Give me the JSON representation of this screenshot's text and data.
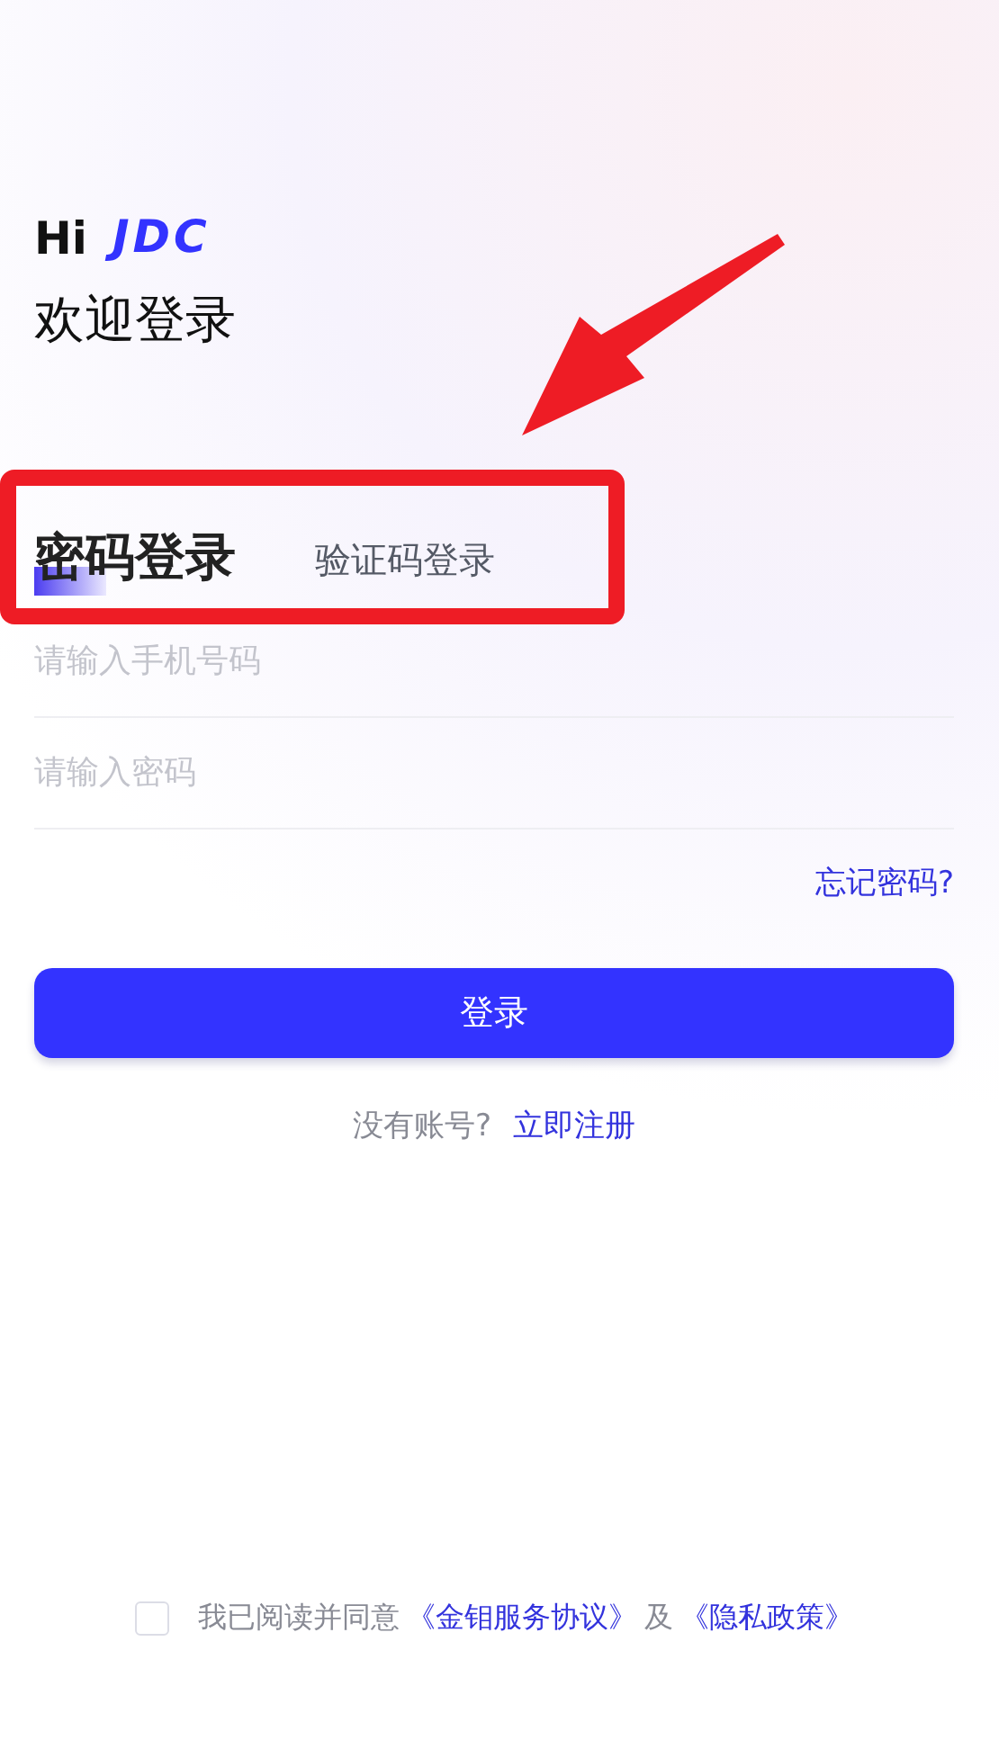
{
  "greeting": {
    "hi": "Hi",
    "brand": "JDC",
    "welcome": "欢迎登录"
  },
  "tabs": [
    {
      "label": "密码登录",
      "selected": true
    },
    {
      "label": "验证码登录",
      "selected": false
    }
  ],
  "fields": [
    {
      "placeholder": "请输入手机号码"
    },
    {
      "placeholder": "请输入密码"
    }
  ],
  "forgot_link": "忘记密码?",
  "login_button": "登录",
  "register": {
    "prompt": "没有账号?",
    "link": "立即注册"
  },
  "agreement": {
    "checked": false,
    "text": "我已阅读并同意",
    "link_1": "《金钼服务协议》",
    "joiner": "及",
    "link_2": "《隐私政策》"
  },
  "annotation": {
    "kind": "arrow-box"
  }
}
